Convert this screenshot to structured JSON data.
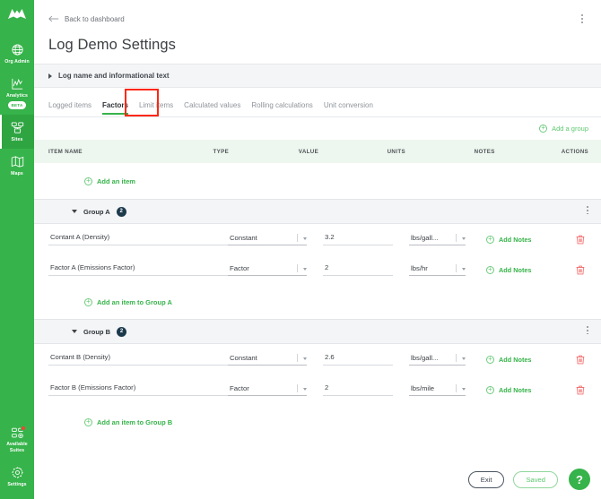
{
  "sidebar": {
    "brand": "mountain-logo",
    "items": [
      {
        "label": "Org Admin",
        "icon": "globe-icon",
        "active": false
      },
      {
        "label": "Analytics",
        "icon": "analytics-chart-icon",
        "active": false,
        "badge": "BETA"
      },
      {
        "label": "Sites",
        "icon": "sites-grid-icon",
        "active": true
      },
      {
        "label": "Maps",
        "icon": "map-icon",
        "active": false
      }
    ],
    "bottom_items": [
      {
        "label": "Available\nSuites",
        "label_line1": "Available",
        "label_line2": "Suites",
        "icon": "available-suites-icon",
        "has_notification": true
      },
      {
        "label": "Settings",
        "icon": "gear-icon",
        "has_notification": false
      }
    ],
    "accent_color": "#36b34a"
  },
  "header": {
    "back_label": "Back to dashboard",
    "back_icon": "arrow-left-icon",
    "title": "Log Demo Settings",
    "kebab_icon": "more-vertical-icon"
  },
  "accordion": {
    "label": "Log name and informational text",
    "caret_icon": "caret-right-icon",
    "expanded": false
  },
  "tabs": [
    {
      "label": "Logged items",
      "active": false
    },
    {
      "label": "Factors",
      "active": true
    },
    {
      "label": "Limit items",
      "active": false
    },
    {
      "label": "Calculated values",
      "active": false
    },
    {
      "label": "Rolling calculations",
      "active": false
    },
    {
      "label": "Unit conversion",
      "active": false
    }
  ],
  "annotation": {
    "target": "Factors",
    "color": "#fe2712"
  },
  "toolbar": {
    "add_group_label": "Add a group",
    "add_group_icon": "plus-circle-icon"
  },
  "table": {
    "columns": [
      "ITEM NAME",
      "TYPE",
      "VALUE",
      "UNITS",
      "NOTES",
      "ACTIONS"
    ],
    "ungrouped_add_label": "Add an item"
  },
  "groups": [
    {
      "name": "Group A",
      "count": "2",
      "caret_icon": "caret-down-icon",
      "kebab_icon": "more-vertical-icon",
      "add_item_label": "Add an item to Group A",
      "rows": [
        {
          "name": "Contant A (Density)",
          "type": "Constant",
          "value": "3.2",
          "units": "lbs/gall...",
          "notes_label": "Add Notes",
          "delete_icon": "trash-icon"
        },
        {
          "name": "Factor A (Emissions Factor)",
          "type": "Factor",
          "value": "2",
          "units": "lbs/hr",
          "notes_label": "Add Notes",
          "delete_icon": "trash-icon"
        }
      ]
    },
    {
      "name": "Group B",
      "count": "2",
      "caret_icon": "caret-down-icon",
      "kebab_icon": "more-vertical-icon",
      "add_item_label": "Add an item to Group B",
      "rows": [
        {
          "name": "Contant B (Density)",
          "type": "Constant",
          "value": "2.6",
          "units": "lbs/gall...",
          "notes_label": "Add Notes",
          "delete_icon": "trash-icon"
        },
        {
          "name": "Factor B (Emissions Factor)",
          "type": "Factor",
          "value": "2",
          "units": "lbs/mile",
          "notes_label": "Add Notes",
          "delete_icon": "trash-icon"
        }
      ]
    }
  ],
  "footer": {
    "exit_label": "Exit",
    "saved_label": "Saved",
    "help_label": "?"
  }
}
